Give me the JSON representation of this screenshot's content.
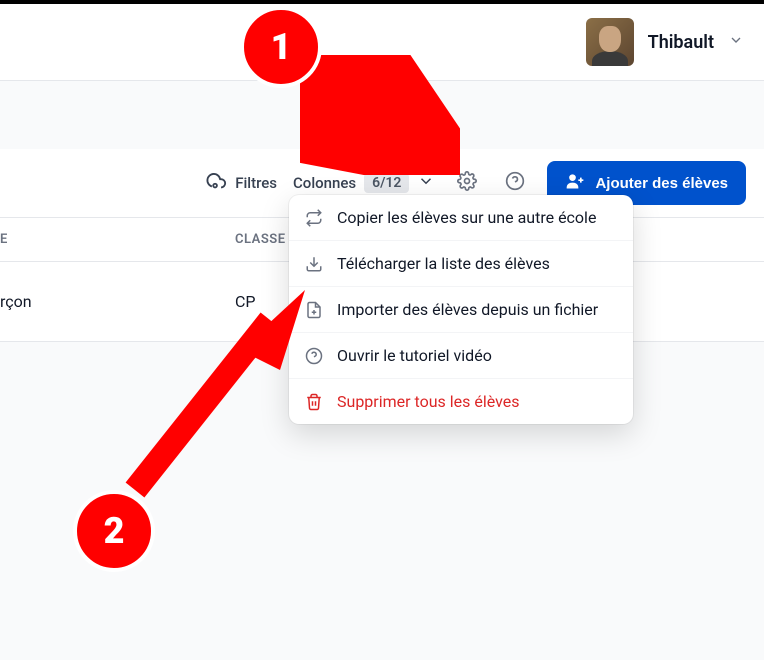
{
  "header": {
    "username": "Thibault"
  },
  "toolbar": {
    "filters_label": "Filtres",
    "columns_label": "Colonnes",
    "columns_count": "6/12",
    "add_button_label": "Ajouter des élèves"
  },
  "table": {
    "headers": {
      "e": "E",
      "classe": "CLASSE"
    },
    "rows": [
      {
        "e": "rçon",
        "classe": "CP"
      }
    ]
  },
  "menu": {
    "items": [
      {
        "label": "Copier les élèves sur une autre école",
        "icon": "swap-icon"
      },
      {
        "label": "Télécharger la liste des élèves",
        "icon": "download-icon"
      },
      {
        "label": "Importer des élèves depuis un fichier",
        "icon": "file-plus-icon"
      },
      {
        "label": "Ouvrir le tutoriel vidéo",
        "icon": "help-circle-icon"
      },
      {
        "label": "Supprimer tous les élèves",
        "icon": "trash-icon",
        "danger": true
      }
    ]
  },
  "annotations": {
    "step1": "1",
    "step2": "2"
  }
}
